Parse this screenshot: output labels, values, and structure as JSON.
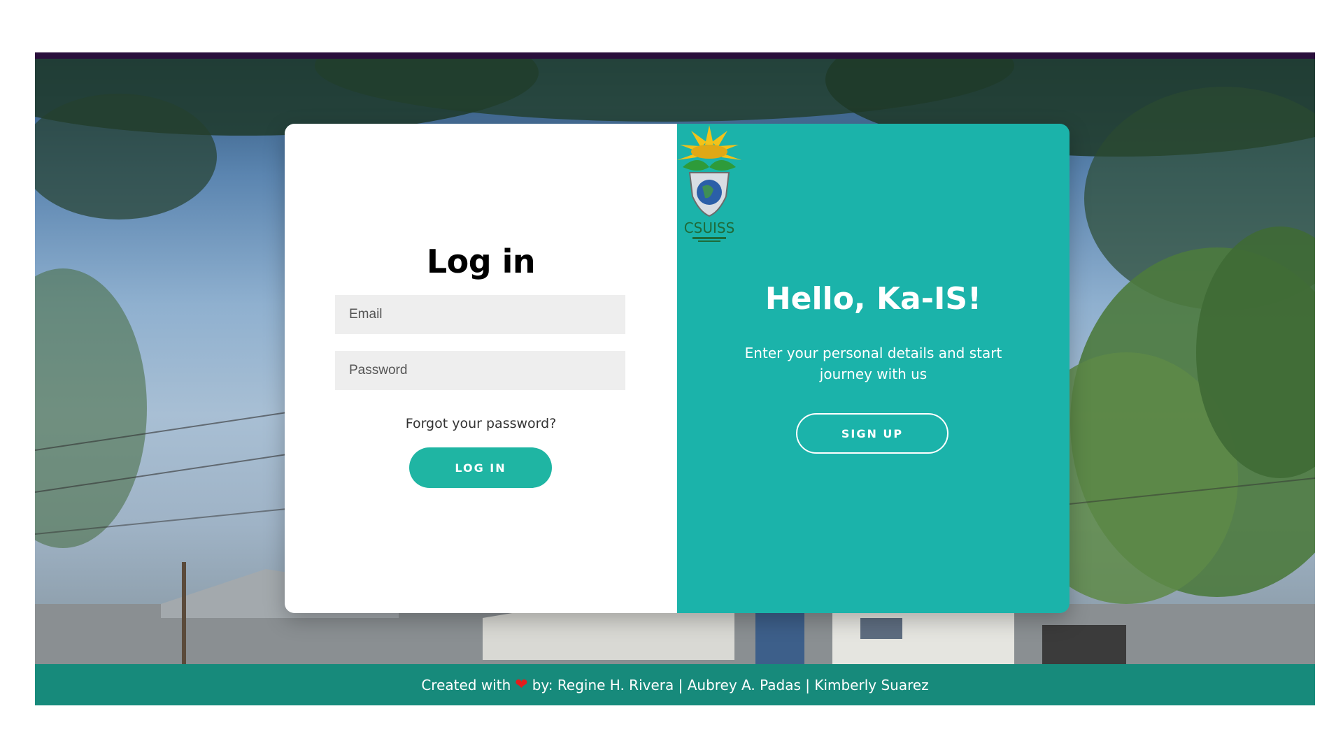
{
  "login": {
    "title": "Log in",
    "email_placeholder": "Email",
    "password_placeholder": "Password",
    "forgot_label": "Forgot your password?",
    "login_button": "LOG IN"
  },
  "welcome": {
    "logo_text": "CSUISS",
    "heading": "Hello, Ka-IS!",
    "tagline": "Enter your personal details and start journey with us",
    "signup_button": "SIGN UP"
  },
  "footer": {
    "prefix": "Created with",
    "heart_icon": "heart-icon",
    "suffix": "by: Regine H. Rivera | Aubrey A. Padas | Kimberly Suarez"
  },
  "colors": {
    "top_bar": "#2a0f3c",
    "panel_teal": "#1bb3aa",
    "login_button": "#1fb5a3",
    "footer": "#178a7b",
    "heart": "#e21d1d"
  }
}
